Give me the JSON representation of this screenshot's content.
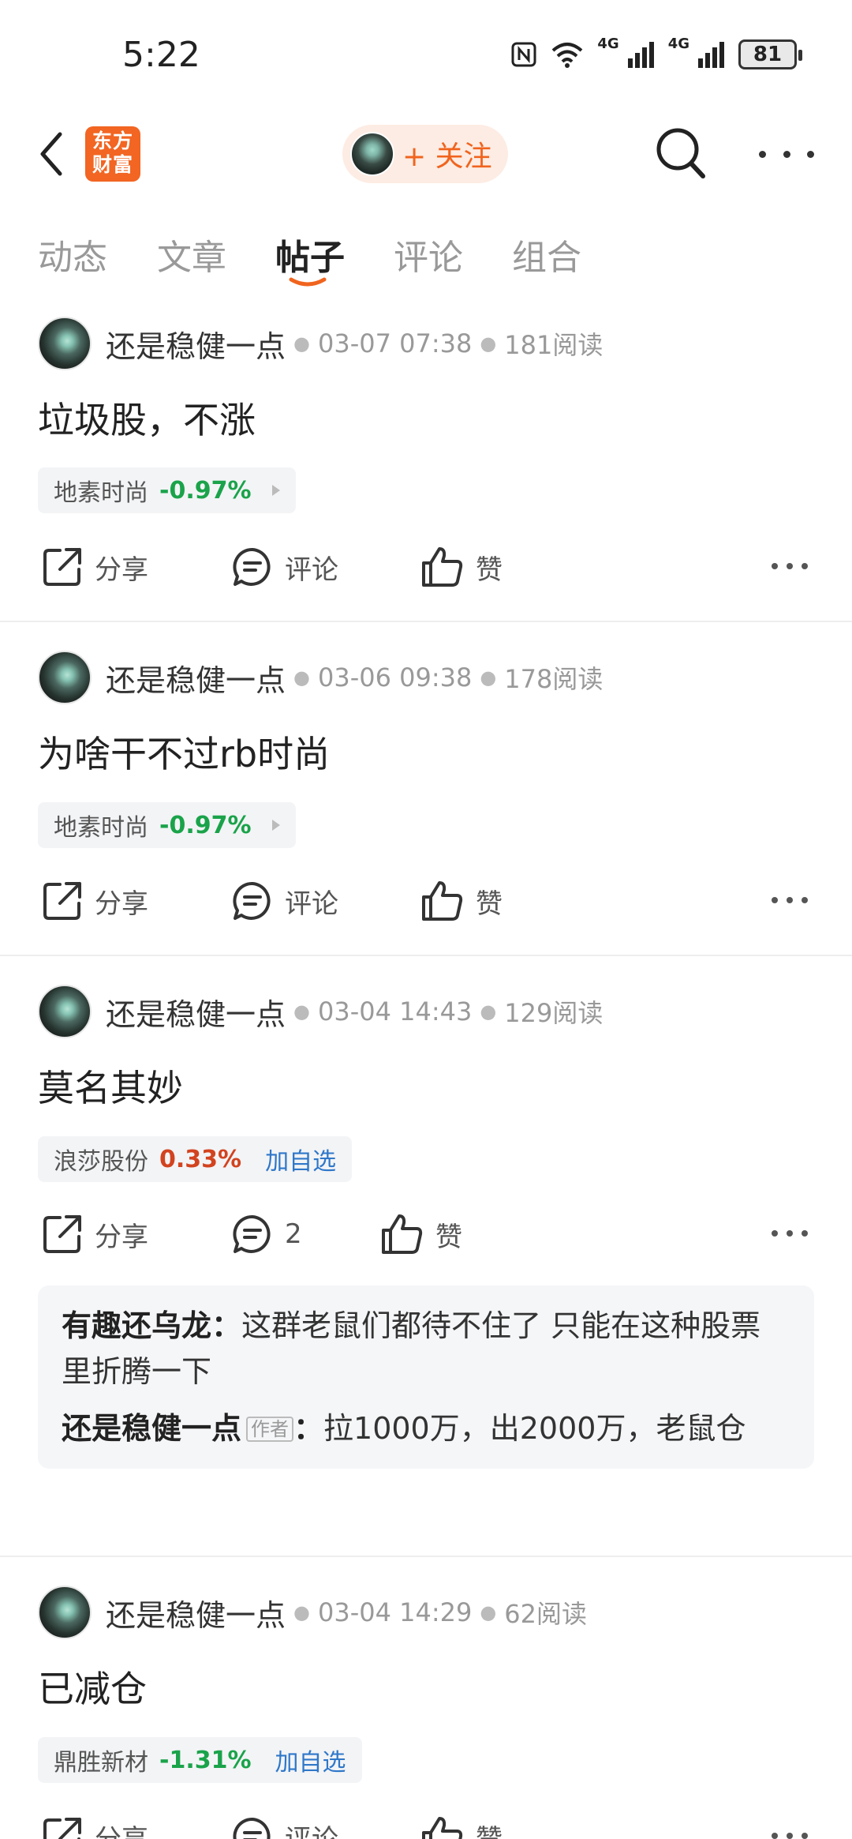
{
  "status_bar": {
    "time": "5:22",
    "network_1": "4G",
    "network_2": "4G",
    "battery": "81"
  },
  "nav": {
    "logo_line1": "东方",
    "logo_line2": "财富",
    "follow_label": "+ 关注"
  },
  "tabs": [
    {
      "label": "动态"
    },
    {
      "label": "文章"
    },
    {
      "label": "帖子"
    },
    {
      "label": "评论"
    },
    {
      "label": "组合"
    }
  ],
  "active_tab": "帖子",
  "actions": {
    "share": "分享",
    "comment": "评论",
    "like": "赞"
  },
  "posts": [
    {
      "author": "还是稳健一点",
      "time": "03-07 07:38",
      "reads": "181阅读",
      "title": "垃圾股，不涨",
      "stock": {
        "name": "地素时尚",
        "change": "-0.97%"
      },
      "comment_label": "评论"
    },
    {
      "author": "还是稳健一点",
      "time": "03-06 09:38",
      "reads": "178阅读",
      "title": "为啥干不过rb时尚",
      "stock": {
        "name": "地素时尚",
        "change": "-0.97%"
      },
      "comment_label": "评论"
    },
    {
      "author": "还是稳健一点",
      "time": "03-04 14:43",
      "reads": "129阅读",
      "title": "莫名其妙",
      "stock": {
        "name": "浪莎股份",
        "change": "0.33%",
        "add": "加自选"
      },
      "comment_label": "2",
      "comments": [
        {
          "author": "有趣还乌龙",
          "text": "这群老鼠们都待不住了 只能在这种股票里折腾一下"
        },
        {
          "author": "还是稳健一点",
          "badge": "作者",
          "text": "拉1000万，出2000万，老鼠仓"
        }
      ]
    },
    {
      "author": "还是稳健一点",
      "time": "03-04 14:29",
      "reads": "62阅读",
      "title": "已减仓",
      "stock": {
        "name": "鼎胜新材",
        "change": "-1.31%",
        "add": "加自选"
      },
      "comment_label": "评论"
    }
  ],
  "colors": {
    "accent": "#f0641e",
    "down": "#1aa34a",
    "up": "#d2431f",
    "link": "#2f77c9"
  }
}
